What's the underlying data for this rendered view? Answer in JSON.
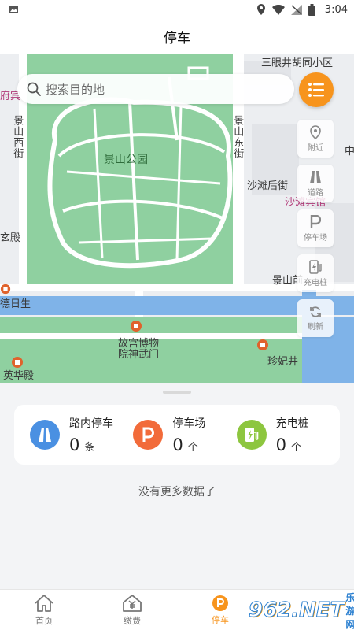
{
  "status_bar": {
    "time": "3:04"
  },
  "header": {
    "title": "停车"
  },
  "search": {
    "placeholder": "搜索目的地"
  },
  "map": {
    "labels": {
      "sanyan": "三眼井胡同小区",
      "jingshan_park": "景山公园",
      "jingshan_west": "景山西街",
      "jingshan_east": "景山东街",
      "shatan_back": "沙滩后街",
      "shatan_hotel": "沙滩宾馆",
      "jingshan_front": "景山前",
      "shenwumen": "故宫博物院神武门",
      "zhenfei": "珍妃井",
      "yinghua": "英华殿",
      "xuanyao": "玄殿",
      "guest": "府宾",
      "desheng": "德日生",
      "zhong": "中"
    }
  },
  "tools": [
    {
      "label": "附近",
      "icon": "location-pin-icon"
    },
    {
      "label": "道路",
      "icon": "road-icon"
    },
    {
      "label": "停车场",
      "icon": "parking-icon"
    },
    {
      "label": "充电桩",
      "icon": "charger-icon"
    },
    {
      "label": "刷新",
      "icon": "refresh-icon"
    }
  ],
  "stats": [
    {
      "label": "路内停车",
      "count": "0",
      "unit": "条",
      "icon": "road-icon",
      "color": "#4a90e2"
    },
    {
      "label": "停车场",
      "count": "0",
      "unit": "个",
      "icon": "parking-icon",
      "color": "#f26b3a"
    },
    {
      "label": "充电桩",
      "count": "0",
      "unit": "个",
      "icon": "charger-icon",
      "color": "#8dc63f"
    }
  ],
  "no_more": "没有更多数据了",
  "tabs": [
    {
      "label": "首页",
      "icon": "home-icon"
    },
    {
      "label": "缴费",
      "icon": "payment-icon"
    },
    {
      "label": "停车",
      "icon": "parking-icon",
      "active": true
    }
  ],
  "watermark": {
    "text": "962.NET",
    "sub": "乐游网"
  },
  "colors": {
    "accent": "#f7941d",
    "park": "#8fd0a0",
    "water": "#7fb3e8"
  }
}
